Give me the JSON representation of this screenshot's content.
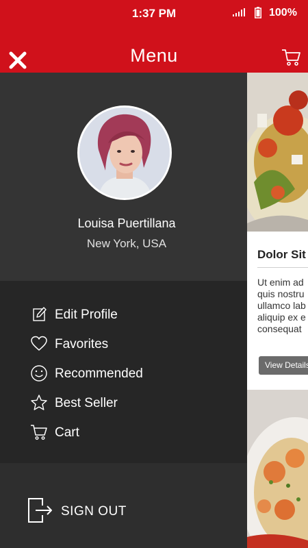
{
  "status": {
    "time": "1:37 PM",
    "battery": "100%"
  },
  "header": {
    "title": "Menu",
    "close_icon": "close-icon",
    "cart_icon": "cart-icon"
  },
  "profile": {
    "name": "Louisa Puertillana",
    "location": "New York, USA"
  },
  "menu": {
    "items": [
      {
        "label": "Edit Profile",
        "icon": "edit-icon"
      },
      {
        "label": "Favorites",
        "icon": "heart-icon"
      },
      {
        "label": "Recommended",
        "icon": "smiley-icon"
      },
      {
        "label": "Best Seller",
        "icon": "star-icon"
      },
      {
        "label": "Cart",
        "icon": "cart-icon"
      }
    ],
    "sign_out": "SIGN OUT"
  },
  "content": {
    "card": {
      "title": "Dolor Sit",
      "body_lines": [
        "Ut enim ad",
        "quis nostru",
        "ullamco lab",
        "aliquip ex e",
        "consequat"
      ],
      "button": "View Details"
    }
  },
  "colors": {
    "accent": "#d0111b",
    "drawer": "#2e2e2e",
    "menu_bg": "#262626",
    "button": "#6b6b6b"
  }
}
